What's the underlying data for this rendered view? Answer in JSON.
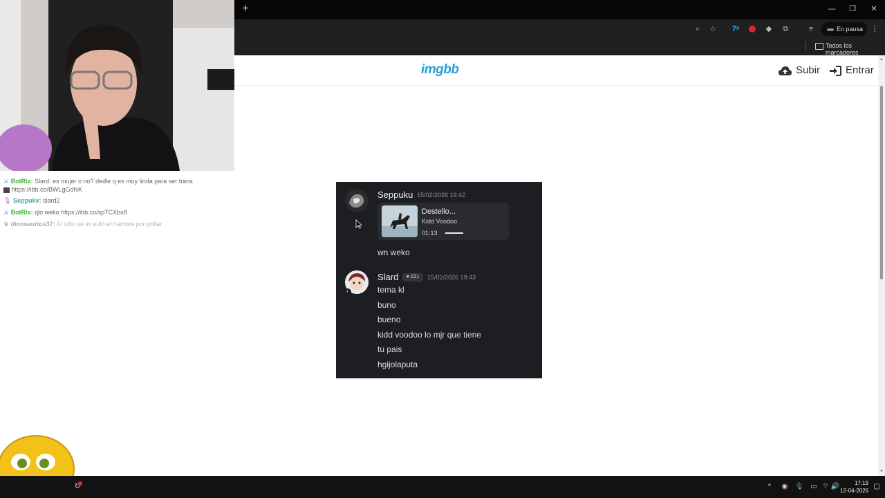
{
  "browser": {
    "profile_label": "En pausa",
    "bookmarks_label": "Todos los marcadores"
  },
  "site": {
    "logo": "imgbb",
    "upload_label": "Subir",
    "login_label": "Entrar"
  },
  "discord": {
    "messages": [
      {
        "author": "Seppuku",
        "timestamp": "15/02/2026 19:42",
        "embed": {
          "song": "Destello...",
          "artist": "Kidd Voodoo",
          "elapsed": "01:13"
        },
        "lines": [
          "wn weko"
        ]
      },
      {
        "author": "Slard",
        "badge": "ZZ1",
        "timestamp": "15/02/2026 19:43",
        "lines": [
          "tema kl",
          "buno",
          "bueno",
          "kidd voodoo lo mjr que tiene",
          "tu pais",
          "hgijolaputa"
        ]
      }
    ]
  },
  "stream_chat": [
    {
      "user": "BotRix:",
      "text": "Slard: es mujer o no? dedle q es muy linda para ser trans"
    },
    {
      "user": "",
      "text": "https://ibb.co/BWLgGdNK"
    },
    {
      "user": "Seppukv:",
      "text": "slard2"
    },
    {
      "user": "BotRix:",
      "text": "qlo weko https://ibb.co/spTCXbx8"
    },
    {
      "user": "dinosaurios37:",
      "text": "Al niño se lo suiló el hambre por pollar"
    }
  ],
  "taskbar": {
    "time": "17:19",
    "date": "12-04-2026"
  },
  "colors": {
    "logo_blue": "#2a9fd6",
    "discord_bg": "#1d1e22",
    "bot_green": "#3fb23f"
  }
}
